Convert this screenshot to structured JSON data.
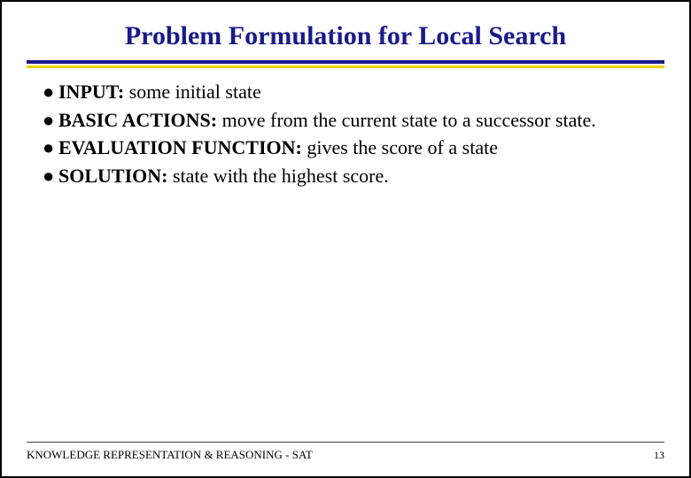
{
  "slide": {
    "title": "Problem Formulation for Local Search",
    "bullets": [
      {
        "label": "INPUT:",
        "body": "some initial state"
      },
      {
        "label": "BASIC ACTIONS:",
        "body": "move from the current state to a successor state."
      },
      {
        "label": "EVALUATION FUNCTION:",
        "body": "gives the score of a state"
      },
      {
        "label": "SOLUTION:",
        "body": "state with the highest score."
      }
    ],
    "footer_left": "KNOWLEDGE REPRESENTATION & REASONING - SAT",
    "page_number": "13"
  }
}
